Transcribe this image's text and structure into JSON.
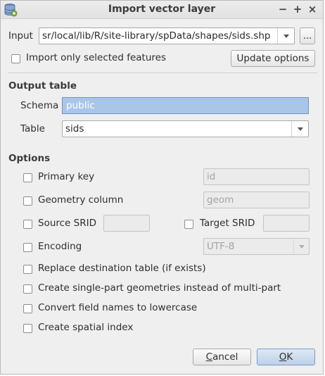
{
  "window": {
    "title": "Import vector layer",
    "controls": {
      "minimize": "−",
      "maximize": "+",
      "close": "×"
    }
  },
  "input": {
    "label": "Input",
    "value": "sr/local/lib/R/site-library/spData/shapes/sids.shp",
    "browse_label": "..."
  },
  "import_selected": {
    "label": "Import only selected features",
    "checked": false
  },
  "update_button": "Update options",
  "output_table": {
    "heading": "Output table",
    "schema_label": "Schema",
    "schema_value": "public",
    "table_label": "Table",
    "table_value": "sids"
  },
  "options": {
    "heading": "Options",
    "primary_key": {
      "label": "Primary key",
      "value": "id"
    },
    "geometry_column": {
      "label": "Geometry column",
      "value": "geom"
    },
    "source_srid": {
      "label": "Source SRID",
      "value": ""
    },
    "target_srid": {
      "label": "Target SRID",
      "value": ""
    },
    "encoding": {
      "label": "Encoding",
      "value": "UTF-8"
    },
    "replace_table": "Replace destination table (if exists)",
    "single_part": "Create single-part geometries instead of multi-part",
    "lowercase": "Convert field names to lowercase",
    "spatial_index": "Create spatial index"
  },
  "buttons": {
    "cancel_first": "C",
    "cancel_rest": "ancel",
    "ok_first": "O",
    "ok_rest": "K"
  },
  "colors": {
    "accent": "#a9c6e8",
    "primary_button": "#bcd0ea",
    "window_bg": "#efefef"
  },
  "icons": {
    "app": "database-import-icon",
    "dropdown": "chevron-down-icon"
  }
}
